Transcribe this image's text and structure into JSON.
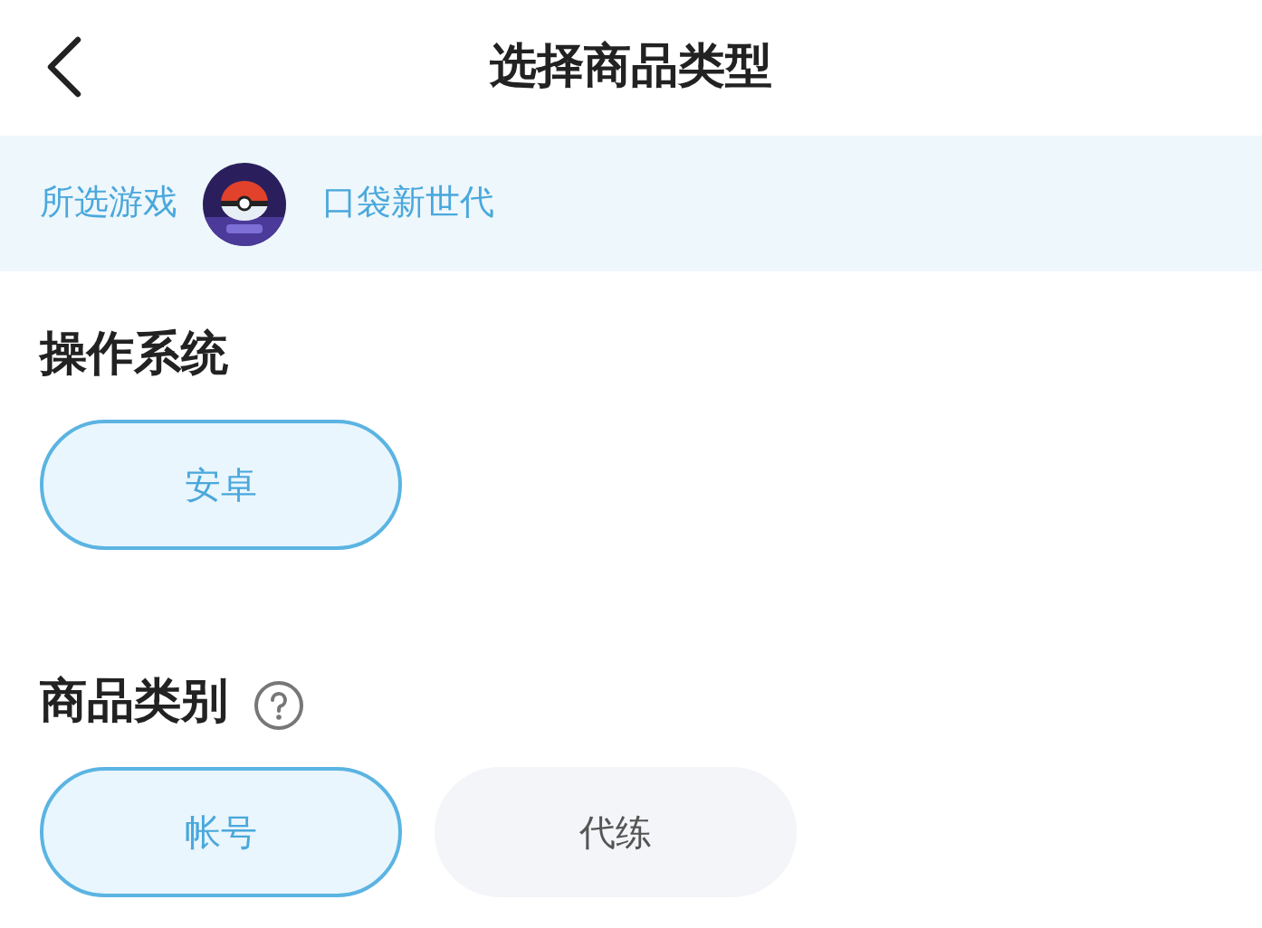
{
  "header": {
    "title": "选择商品类型"
  },
  "game": {
    "label": "所选游戏",
    "name": "口袋新世代"
  },
  "sections": [
    {
      "title": "操作系统",
      "help": false,
      "options": [
        {
          "label": "安卓",
          "selected": true
        }
      ]
    },
    {
      "title": "商品类别",
      "help": true,
      "options": [
        {
          "label": "帐号",
          "selected": true
        },
        {
          "label": "代练",
          "selected": false
        }
      ]
    }
  ]
}
